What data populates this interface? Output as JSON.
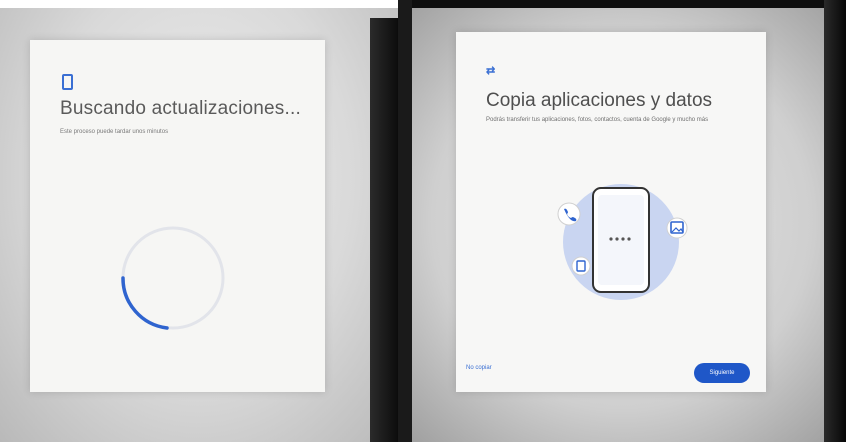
{
  "left_screen": {
    "title": "Buscando actualizaciones...",
    "subtitle": "Este proceso puede tardar unos minutos",
    "icon": "phone-icon",
    "spinner": "progress-spinner"
  },
  "right_screen": {
    "title": "Copia aplicaciones y datos",
    "description": "Podrás transferir tus aplicaciones, fotos, contactos, cuenta de Google y mucho más",
    "icon": "transfer-icon",
    "illustration_icons": [
      "phone-call-icon",
      "image-icon",
      "document-icon"
    ],
    "skip_label": "No copiar",
    "next_label": "Siguiente"
  },
  "colors": {
    "accent": "#1f57c8",
    "title_text": "#5a5a5a",
    "illustration_circle": "#c7d3f2"
  }
}
